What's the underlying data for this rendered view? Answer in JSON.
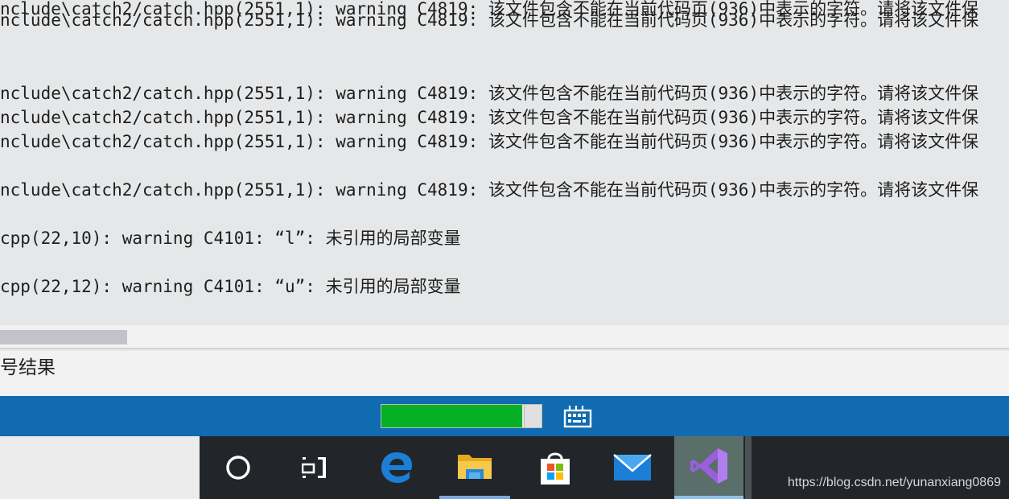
{
  "output": {
    "lines": [
      "nclude\\catch2/catch.hpp(2551,1): warning C4819: 该文件包含不能在当前代码页(936)中表示的字符。请将该文件保",
      "nclude\\catch2/catch.hpp(2551,1): warning C4819: 该文件包含不能在当前代码页(936)中表示的字符。请将该文件保",
      "nclude\\catch2/catch.hpp(2551,1): warning C4819: 该文件包含不能在当前代码页(936)中表示的字符。请将该文件保",
      "nclude\\catch2/catch.hpp(2551,1): warning C4819: 该文件包含不能在当前代码页(936)中表示的字符。请将该文件保",
      "nclude\\catch2/catch.hpp(2551,1): warning C4819: 该文件包含不能在当前代码页(936)中表示的字符。请将该文件保",
      "nclude\\catch2/catch.hpp(2551,1): warning C4819: 该文件包含不能在当前代码页(936)中表示的字符。请将该文件保",
      "cpp(22,10): warning C4101: “l”: 未引用的局部变量",
      "cpp(22,12): warning C4101: “u”: 未引用的局部变量"
    ]
  },
  "panel_tab": {
    "label": "号结果"
  },
  "statusbar": {
    "progress_fraction": 0.88,
    "progress_color": "#06b025",
    "build_icon": "build-status-icon"
  },
  "taskbar": {
    "buttons": [
      {
        "name": "cortana-search-icon"
      },
      {
        "name": "task-view-icon"
      },
      {
        "name": "edge-browser-icon"
      },
      {
        "name": "file-explorer-icon"
      },
      {
        "name": "microsoft-store-icon"
      },
      {
        "name": "mail-icon"
      },
      {
        "name": "visual-studio-icon"
      }
    ],
    "watermark": "https://blog.csdn.net/yunanxiang0869"
  }
}
